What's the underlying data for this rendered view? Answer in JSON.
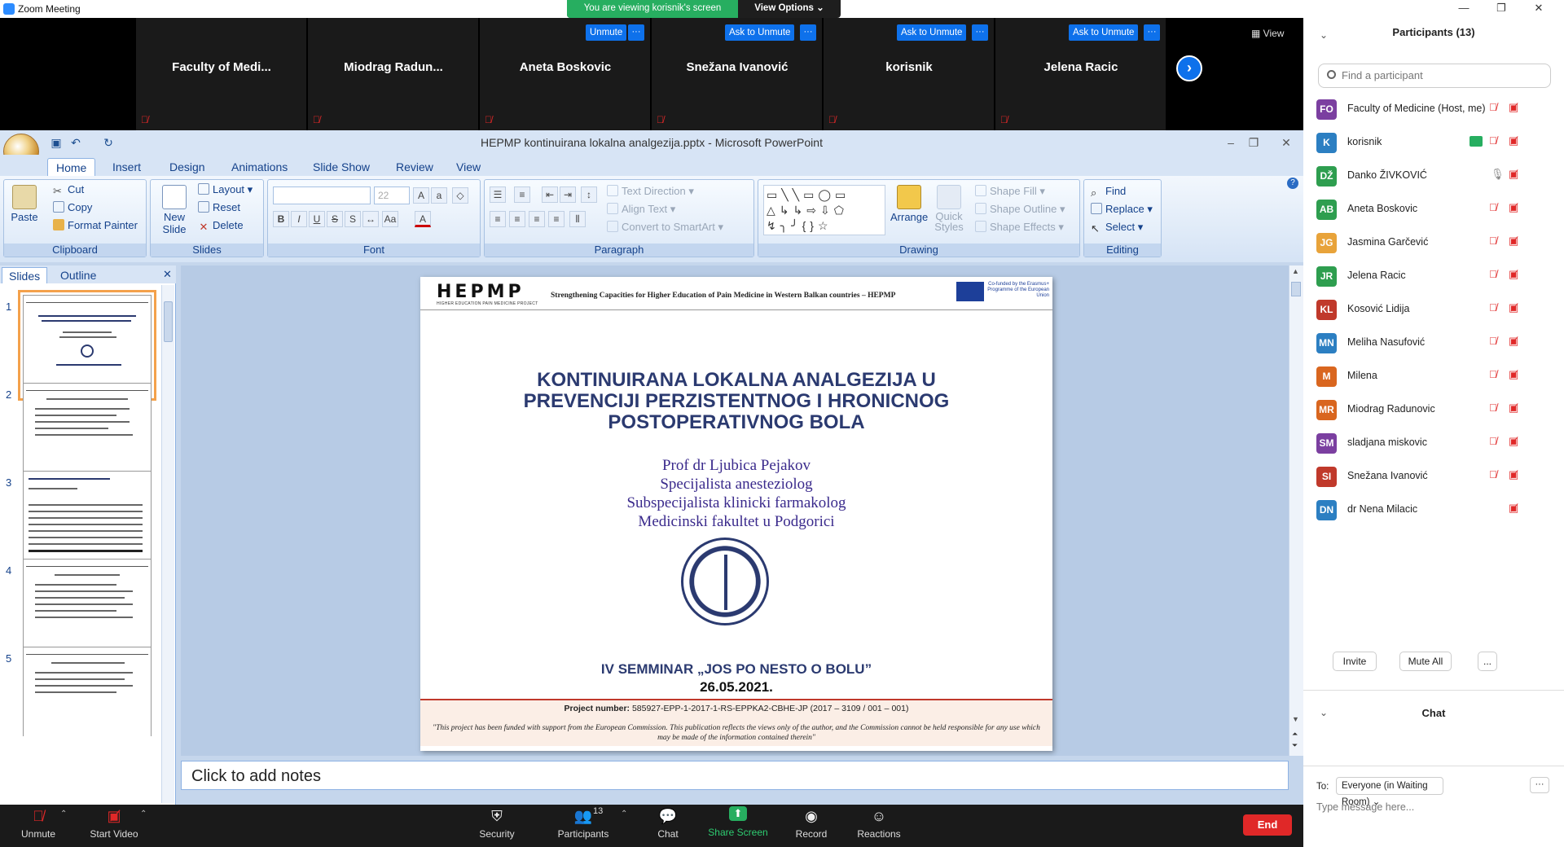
{
  "app": {
    "title": "Zoom Meeting"
  },
  "viewbar": {
    "status": "You are viewing korisnik's screen",
    "options_label": "View Options ⌄"
  },
  "gallery": {
    "tiles": [
      {
        "name": "Faculty  of  Medi..."
      },
      {
        "name": "Miodrag  Radun..."
      },
      {
        "name": "Aneta Boskovic",
        "action": "Unmute"
      },
      {
        "name": "Snežana Ivanović",
        "action": "Ask to Unmute"
      },
      {
        "name": "korisnik",
        "action": "Ask to Unmute"
      },
      {
        "name": "Jelena Racic",
        "action": "Ask to Unmute"
      }
    ],
    "more_dots": "···",
    "view_label": "View",
    "next_icon": "›"
  },
  "ppt": {
    "window_title": "HEPMP kontinuirana lokalna analgezija.pptx - Microsoft PowerPoint",
    "tabs": [
      "Home",
      "Insert",
      "Design",
      "Animations",
      "Slide Show",
      "Review",
      "View"
    ],
    "clipboard": {
      "paste": "Paste",
      "cut": "Cut",
      "copy": "Copy",
      "format_painter": "Format Painter",
      "label": "Clipboard"
    },
    "slides_group": {
      "new_slide": "New Slide",
      "layout": "Layout",
      "reset": "Reset",
      "delete": "Delete",
      "label": "Slides"
    },
    "font": {
      "name": "",
      "size": "22",
      "label": "Font"
    },
    "paragraph": {
      "text_direction": "Text Direction",
      "align_text": "Align Text",
      "smartart": "Convert to SmartArt",
      "label": "Paragraph"
    },
    "drawing": {
      "arrange": "Arrange",
      "quick_styles": "Quick Styles",
      "shape_fill": "Shape Fill",
      "shape_outline": "Shape Outline",
      "shape_effects": "Shape Effects",
      "label": "Drawing"
    },
    "editing": {
      "find": "Find",
      "replace": "Replace",
      "select": "Select",
      "label": "Editing"
    },
    "pane_tabs": {
      "slides": "Slides",
      "outline": "Outline"
    },
    "thumb_numbers": [
      "1",
      "2",
      "3",
      "4",
      "5"
    ],
    "notes_placeholder": "Click to add notes"
  },
  "slide": {
    "logo": "HEPMP",
    "logo_sub": "HIGHER EDUCATION PAIN MEDICINE PROJECT",
    "header_text": "Strengthening Capacities for Higher Education of Pain Medicine in Western Balkan countries – HEPMP",
    "eu_text": "Co-funded by the Erasmus+ Programme of the European Union",
    "title_lines": [
      "KONTINUIRANA LOKALNA ANALGEZIJA U",
      "PREVENCIJI PERZISTENTNOG I HRONICNOG",
      "POSTOPERATIVNOG BOLA"
    ],
    "author_lines": [
      "Prof dr Ljubica Pejakov",
      "Specijalista anesteziolog",
      "Subspecijalista klinicki farmakolog",
      "Medicinski fakultet u Podgorici"
    ],
    "seminar": "IV SEMMINAR   „JOS  PO NESTO O BOLU”",
    "date": "26.05.2021.",
    "project_label": "Project number:",
    "project_number": "585927-EPP-1-2017-1-RS-EPPKA2-CBHE-JP  (2017 – 3109 / 001 – 001)",
    "disclaimer": "\"This project has been funded with support from the European Commission. This publication reflects the views only of the author, and the Commission cannot be held responsible for any use which may be made of the information contained therein\""
  },
  "toolbar": {
    "unmute": "Unmute",
    "start_video": "Start Video",
    "security": "Security",
    "participants": "Participants",
    "participants_count": "13",
    "chat": "Chat",
    "share_screen": "Share Screen",
    "record": "Record",
    "reactions": "Reactions",
    "end": "End"
  },
  "panel": {
    "title": "Participants (13)",
    "search_placeholder": "Find a participant",
    "participants": [
      {
        "initials": "FO",
        "name": "Faculty of Medicine (Host, me)",
        "color": "#7b3fa0"
      },
      {
        "initials": "K",
        "name": "korisnik",
        "color": "#2c7fc2"
      },
      {
        "initials": "DŽ",
        "name": "Danko ŽIVKOVIĆ",
        "color": "#2e9e4f"
      },
      {
        "initials": "AB",
        "name": "Aneta Boskovic",
        "color": "#2e9e4f"
      },
      {
        "initials": "JG",
        "name": "Jasmina Garčević",
        "color": "#e8a33a"
      },
      {
        "initials": "JR",
        "name": "Jelena Racic",
        "color": "#2e9e4f"
      },
      {
        "initials": "KL",
        "name": "Kosović Lidija",
        "color": "#c0392b"
      },
      {
        "initials": "MN",
        "name": "Meliha Nasufović",
        "color": "#2c7fc2"
      },
      {
        "initials": "M",
        "name": "Milena",
        "color": "#d9661f"
      },
      {
        "initials": "MR",
        "name": "Miodrag Radunovic",
        "color": "#d9661f"
      },
      {
        "initials": "SM",
        "name": "sladjana miskovic",
        "color": "#7b3fa0"
      },
      {
        "initials": "SI",
        "name": "Snežana Ivanović",
        "color": "#c0392b"
      },
      {
        "initials": "DN",
        "name": "dr Nena Milacic",
        "color": "#2c7fc2"
      }
    ],
    "invite": "Invite",
    "mute_all": "Mute All",
    "more": "...",
    "chat_title": "Chat",
    "to_label": "To:",
    "to_value": "Everyone (in Waiting Room) ⌄",
    "message_placeholder": "Type message here..."
  }
}
